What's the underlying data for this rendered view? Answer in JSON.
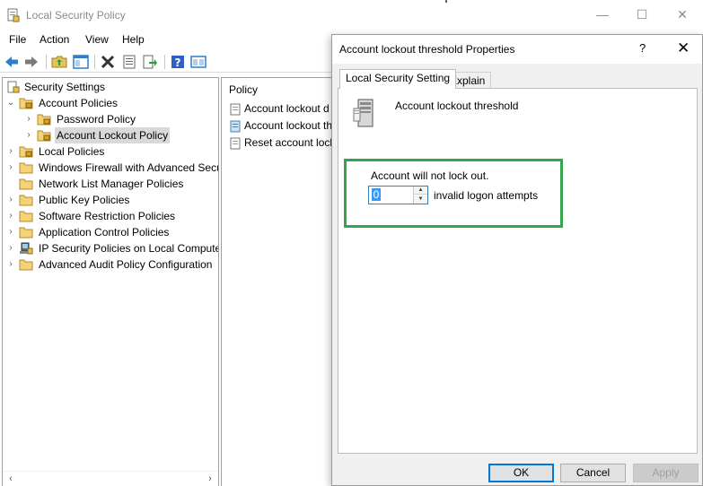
{
  "window": {
    "title": "Local Security Policy",
    "controls": [
      "minimize",
      "maximize",
      "close"
    ]
  },
  "menu": [
    "File",
    "Action",
    "View",
    "Help"
  ],
  "toolbar": {
    "buttons": [
      "back-icon",
      "forward-icon",
      "up-folder-icon",
      "show-hide-tree-icon",
      "delete-icon",
      "properties-icon",
      "export-list-icon",
      "help-icon",
      "console-icon"
    ]
  },
  "tree": {
    "root": "Security Settings",
    "items": [
      {
        "label": "Account Policies",
        "expanded": true
      },
      {
        "label": "Password Policy"
      },
      {
        "label": "Account Lockout Policy",
        "selected": true
      },
      {
        "label": "Local Policies"
      },
      {
        "label": "Windows Firewall with Advanced Secu"
      },
      {
        "label": "Network List Manager Policies"
      },
      {
        "label": "Public Key Policies"
      },
      {
        "label": "Software Restriction Policies"
      },
      {
        "label": "Application Control Policies"
      },
      {
        "label": "IP Security Policies on Local Compute"
      },
      {
        "label": "Advanced Audit Policy Configuration"
      }
    ]
  },
  "list": {
    "header": "Policy",
    "rows": [
      "Account lockout d",
      "Account lockout th",
      "Reset account lock"
    ]
  },
  "dialog": {
    "title": "Account lockout threshold Properties",
    "help": "?",
    "close": "✕",
    "tabs": [
      "Local Security Setting",
      "Explain"
    ],
    "policy_name": "Account lockout threshold",
    "status_text": "Account will not lock out.",
    "threshold_value": "0",
    "threshold_unit": "invalid logon attempts",
    "buttons": {
      "ok": "OK",
      "cancel": "Cancel",
      "apply": "Apply"
    },
    "apply_enabled": false,
    "highlight_color": "#36a34d"
  }
}
